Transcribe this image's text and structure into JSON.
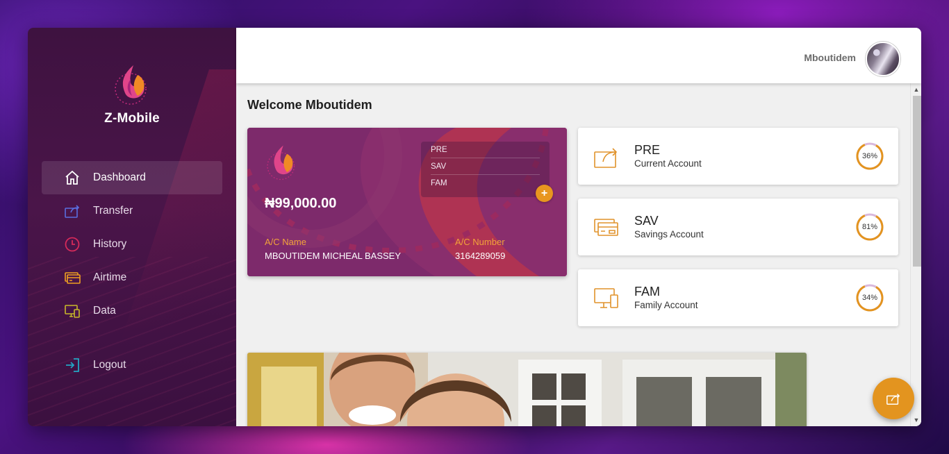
{
  "app": {
    "name": "Z-Mobile"
  },
  "sidebar": {
    "items": [
      {
        "label": "Dashboard",
        "icon": "home-icon"
      },
      {
        "label": "Transfer",
        "icon": "transfer-icon"
      },
      {
        "label": "History",
        "icon": "clock-icon"
      },
      {
        "label": "Airtime",
        "icon": "airtime-card-icon"
      },
      {
        "label": "Data",
        "icon": "data-device-icon"
      }
    ],
    "logout": {
      "label": "Logout",
      "icon": "logout-icon"
    }
  },
  "header": {
    "user_name": "Mboutidem"
  },
  "main": {
    "welcome": "Welcome Mboutidem",
    "card": {
      "balance": "₦99,000.00",
      "accounts": [
        "PRE",
        "SAV",
        "FAM"
      ],
      "add_label": "+",
      "acc_name_label": "A/C Name",
      "acc_name": "MBOUTIDEM MICHEAL BASSEY",
      "acc_number_label": "A/C Number",
      "acc_number": "3164289059"
    },
    "account_tiles": [
      {
        "code": "PRE",
        "description": "Current Account",
        "percent_label": "36%",
        "percent": 36,
        "icon": "share-icon"
      },
      {
        "code": "SAV",
        "description": "Savings Account",
        "percent_label": "81%",
        "percent": 81,
        "icon": "cards-icon"
      },
      {
        "code": "FAM",
        "description": "Family Account",
        "percent_label": "34%",
        "percent": 34,
        "icon": "devices-icon"
      }
    ]
  },
  "colors": {
    "accent": "#e3941f",
    "sidebar": "#4a1549",
    "card": "#7c2a6a",
    "gauge_track": "#d9b8dc"
  }
}
